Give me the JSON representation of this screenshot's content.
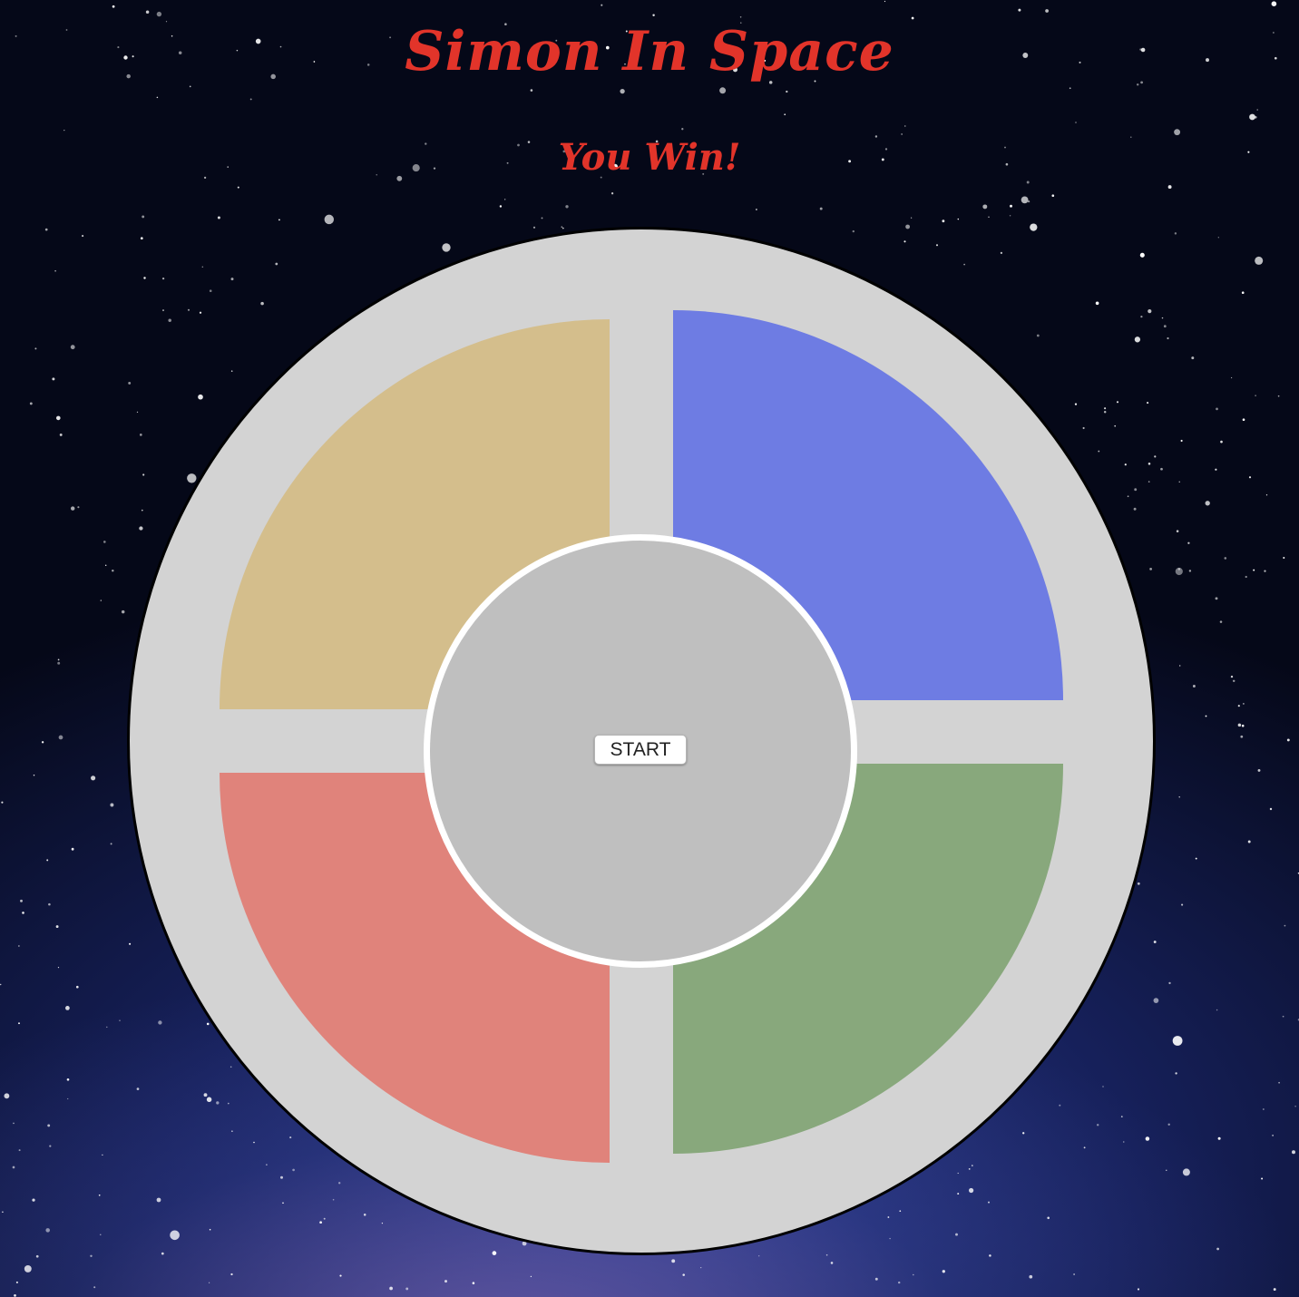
{
  "header": {
    "title": "Simon In Space",
    "status": "You Win!"
  },
  "controls": {
    "start_label": "START"
  },
  "colors": {
    "title": "#e2342a",
    "board_ring": "#d3d3d3",
    "center_disc": "#bfbfbf",
    "pad_top_left": "#d4be8c",
    "pad_top_right": "#6e7ce3",
    "pad_bottom_left": "#e0837b",
    "pad_bottom_right": "#88a87c"
  },
  "background": "starfield"
}
